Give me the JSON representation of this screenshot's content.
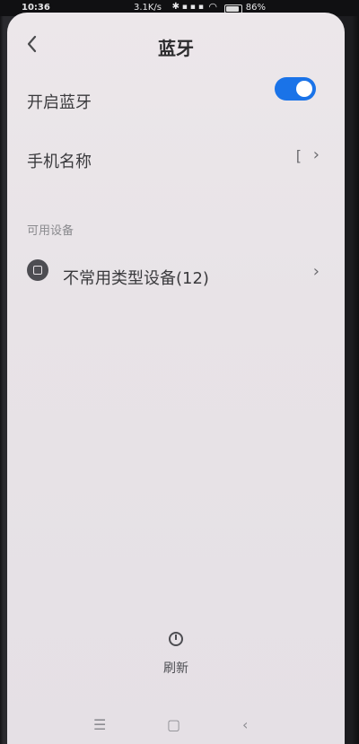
{
  "status_bar": {
    "time": "10:36",
    "net_speed": "3.1K/s",
    "battery": "86%",
    "battery_level": 0.86
  },
  "header": {
    "title": "蓝牙",
    "back_icon": "chevron-left-icon"
  },
  "settings": {
    "bluetooth_label": "开启蓝牙",
    "bluetooth_enabled": true,
    "device_name_label": "手机名称",
    "device_name_value": "["
  },
  "available": {
    "section_title": "可用设备",
    "items": [
      {
        "label": "不常用类型设备(12)"
      }
    ]
  },
  "footer": {
    "refresh_label": "刷新",
    "refresh_icon": "refresh-icon"
  },
  "nav": {
    "menu_icon": "menu-icon",
    "home_icon": "home-icon",
    "back_icon": "back-icon"
  },
  "colors": {
    "accent": "#1a73e8",
    "background": "#e8e3e7",
    "text": "#3a3a3d"
  }
}
